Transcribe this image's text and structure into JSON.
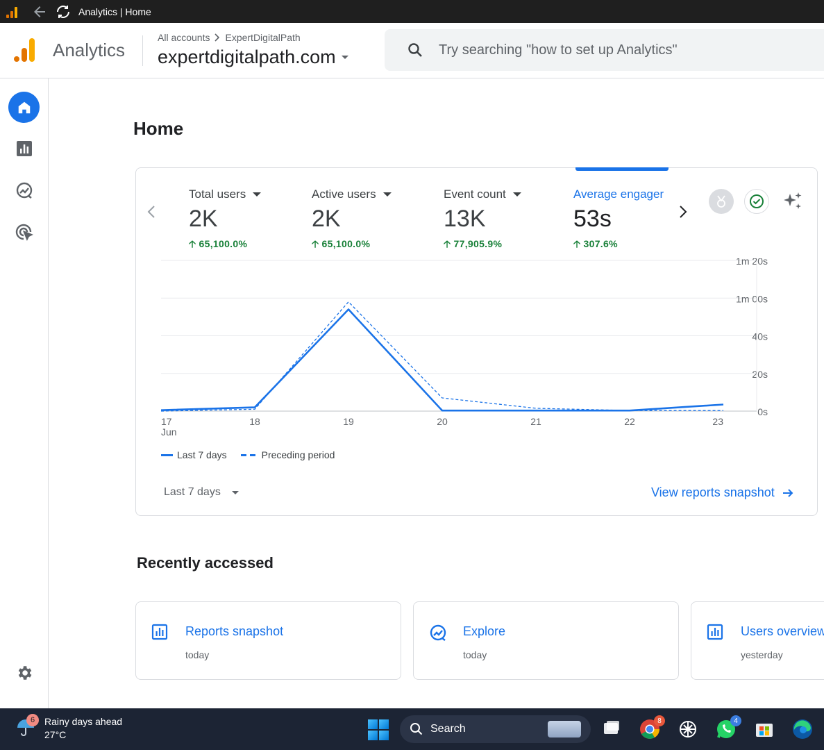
{
  "window": {
    "title": "Analytics | Home"
  },
  "header": {
    "app_name": "Analytics",
    "breadcrumb": {
      "root": "All accounts",
      "account": "ExpertDigitalPath"
    },
    "property": "expertdigitalpath.com",
    "search_placeholder": "Try searching \"how to set up Analytics\""
  },
  "sidebar": {
    "items": [
      {
        "name": "Home",
        "icon": "home-icon",
        "active": true
      },
      {
        "name": "Reports",
        "icon": "bar-chart-icon"
      },
      {
        "name": "Explore",
        "icon": "explore-icon"
      },
      {
        "name": "Advertising",
        "icon": "cursor-target-icon"
      }
    ],
    "settings_icon": "gear-icon"
  },
  "main": {
    "title": "Home",
    "metrics": [
      {
        "label": "Total users",
        "value": "2K",
        "delta": "65,100.0%"
      },
      {
        "label": "Active users",
        "value": "2K",
        "delta": "65,100.0%"
      },
      {
        "label": "Event count",
        "value": "13K",
        "delta": "77,905.9%"
      },
      {
        "label": "Average engager",
        "value": "53s",
        "delta": "307.6%",
        "active": true
      }
    ],
    "legend": {
      "current": "Last 7 days",
      "previous": "Preceding period"
    },
    "date_range": "Last 7 days",
    "view_link": "View reports snapshot",
    "accent_color": "#1a73e8",
    "positive_color": "#188038"
  },
  "chart_data": {
    "type": "line",
    "x": [
      "17",
      "18",
      "19",
      "20",
      "21",
      "22",
      "23"
    ],
    "x_month_label": "Jun",
    "y_ticks": [
      "0s",
      "20s",
      "40s",
      "1m 00s",
      "1m 20s"
    ],
    "ylim": [
      0,
      80
    ],
    "y_unit": "seconds",
    "series": [
      {
        "name": "Last 7 days",
        "style": "solid",
        "values": [
          0.5,
          2,
          54,
          0.3,
          0.3,
          0.3,
          3.5
        ]
      },
      {
        "name": "Preceding period",
        "style": "dashed",
        "values": [
          0,
          1,
          58,
          7,
          1.5,
          0.3,
          0.3
        ]
      }
    ]
  },
  "recent": {
    "title": "Recently accessed",
    "items": [
      {
        "title": "Reports snapshot",
        "when": "today",
        "icon": "bar-chart-icon"
      },
      {
        "title": "Explore",
        "when": "today",
        "icon": "explore-icon"
      },
      {
        "title": "Users overview",
        "when": "yesterday",
        "icon": "bar-chart-icon"
      }
    ]
  },
  "taskbar": {
    "weather": {
      "text": "Rainy days ahead",
      "temp": "27°C",
      "badge": "6"
    },
    "search_label": "Search",
    "chrome_badge": "8",
    "whatsapp_badge": "4"
  }
}
